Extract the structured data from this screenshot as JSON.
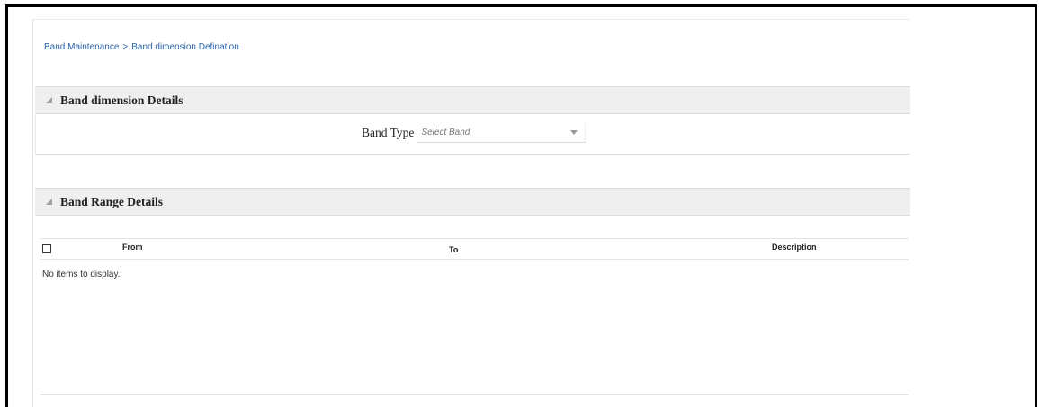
{
  "breadcrumb": {
    "items": [
      "Band Maintenance",
      "Band dimension Defination"
    ],
    "separator": ">"
  },
  "band_dimension_panel": {
    "title": "Band dimension Details",
    "band_type_label": "Band Type",
    "band_type_placeholder": "Select Band"
  },
  "band_range_panel": {
    "title": "Band Range Details",
    "columns": [
      "From",
      "To",
      "Description"
    ],
    "empty_message": "No items to display."
  },
  "colors": {
    "link": "#2d64a8",
    "panel_header_bg": "#efefef"
  }
}
